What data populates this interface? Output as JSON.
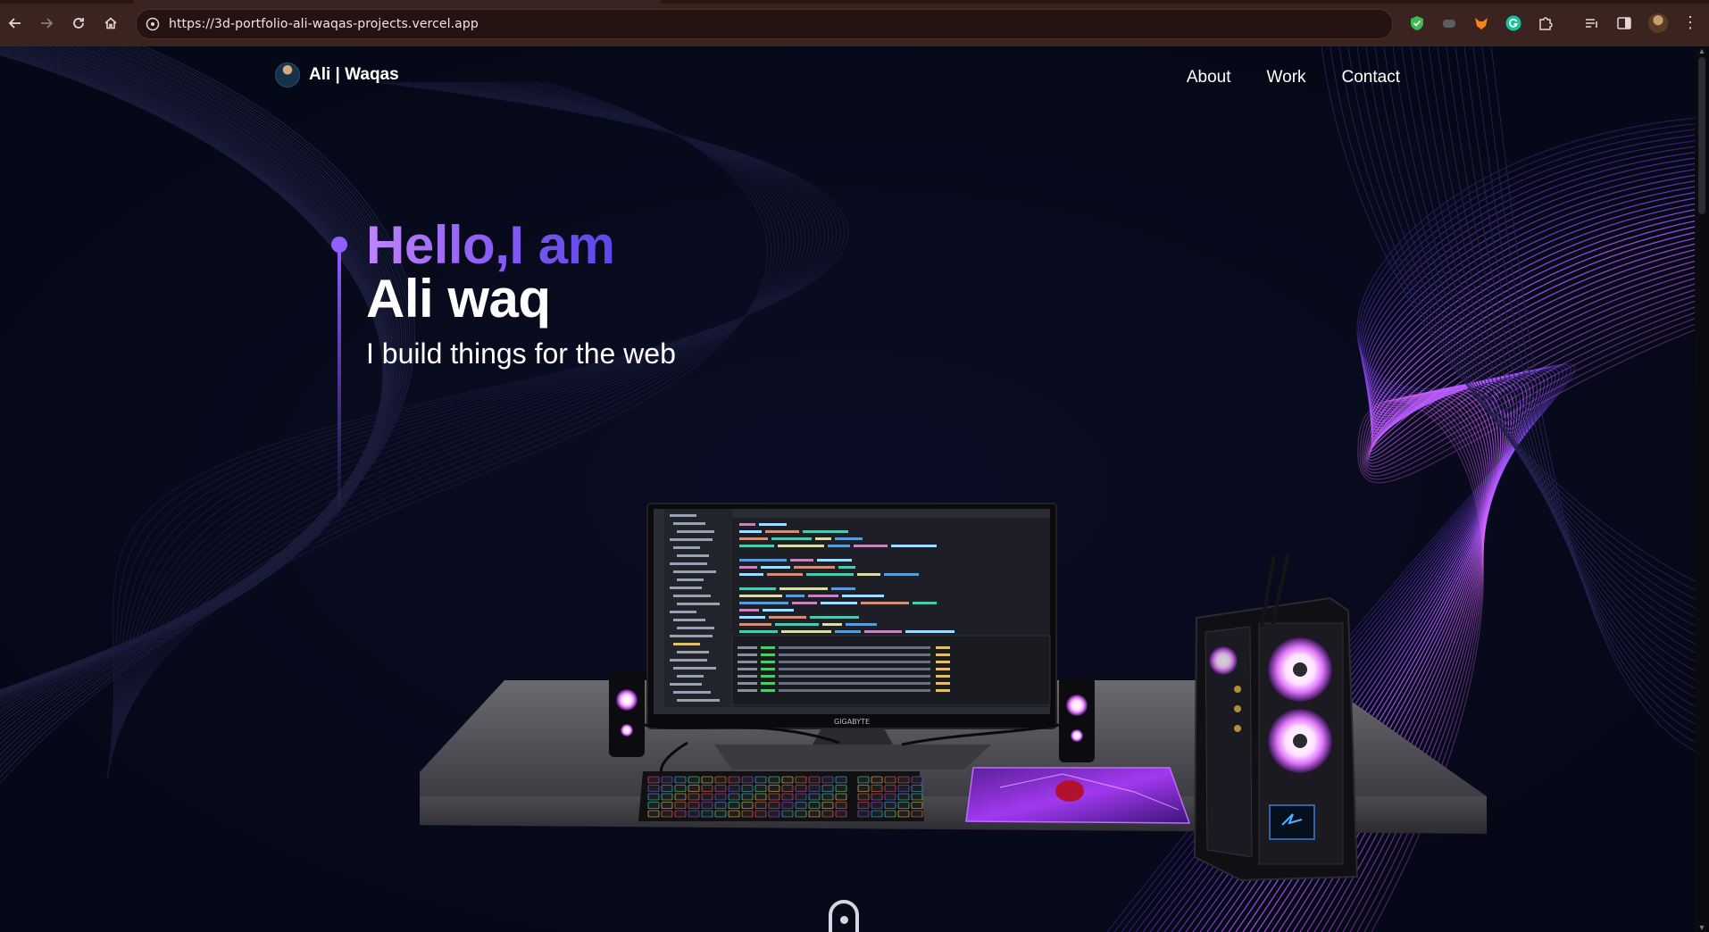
{
  "browser": {
    "url": "https://3d-portfolio-ali-waqas-projects.vercel.app",
    "back_icon": "arrow-left-icon",
    "forward_icon": "arrow-right-icon",
    "reload_icon": "reload-icon",
    "home_icon": "home-icon",
    "extensions": [
      "shield-extension-icon",
      "gamepad-extension-icon",
      "fox-extension-icon",
      "grammarly-extension-icon",
      "puzzle-extensions-icon",
      "media-control-icon",
      "side-panel-icon"
    ],
    "menu_icon": "kebab-menu-icon"
  },
  "navbar": {
    "brand": "Ali | Waqas",
    "links": [
      "About",
      "Work",
      "Contact"
    ]
  },
  "hero": {
    "greeting": "Hello,I am",
    "name": "Ali waq",
    "subtitle": "I build things for the web"
  },
  "scene": {
    "monitor_brand": "GIGABYTE"
  },
  "colors": {
    "background": "#050816",
    "accent": "#915eff",
    "chrome": "#3b2320"
  }
}
